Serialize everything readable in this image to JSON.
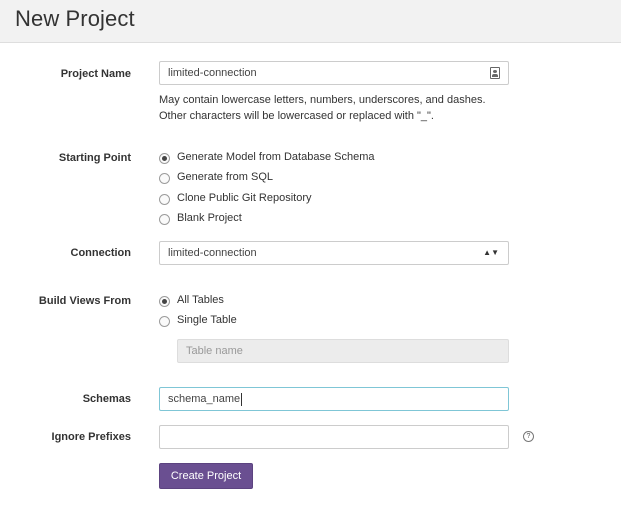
{
  "header": {
    "title": "New Project"
  },
  "form": {
    "project_name": {
      "label": "Project Name",
      "value": "limited-connection",
      "help_line1": "May contain lowercase letters, numbers, underscores, and dashes.",
      "help_line2": "Other characters will be lowercased or replaced with \"_\"."
    },
    "starting_point": {
      "label": "Starting Point",
      "options": [
        {
          "label": "Generate Model from Database Schema",
          "checked": true
        },
        {
          "label": "Generate from SQL",
          "checked": false
        },
        {
          "label": "Clone Public Git Repository",
          "checked": false
        },
        {
          "label": "Blank Project",
          "checked": false
        }
      ]
    },
    "connection": {
      "label": "Connection",
      "selected": "limited-connection",
      "arrows_glyph": "▲▼"
    },
    "build_views_from": {
      "label": "Build Views From",
      "options": [
        {
          "label": "All Tables",
          "checked": true
        },
        {
          "label": "Single Table",
          "checked": false
        }
      ],
      "table_name_placeholder": "Table name"
    },
    "schemas": {
      "label": "Schemas",
      "value": "schema_name"
    },
    "ignore_prefixes": {
      "label": "Ignore Prefixes",
      "value": "",
      "help_glyph": "?"
    },
    "submit_label": "Create Project"
  },
  "icons": {
    "project_name_field_icon": "contact-card-icon",
    "select_icon": "updown-arrows-icon",
    "ignore_prefixes_help": "help-icon"
  },
  "colors": {
    "primary_button": "#6a4f91",
    "focus_border": "#7fc6d6",
    "header_bg": "#f2f2f2"
  }
}
